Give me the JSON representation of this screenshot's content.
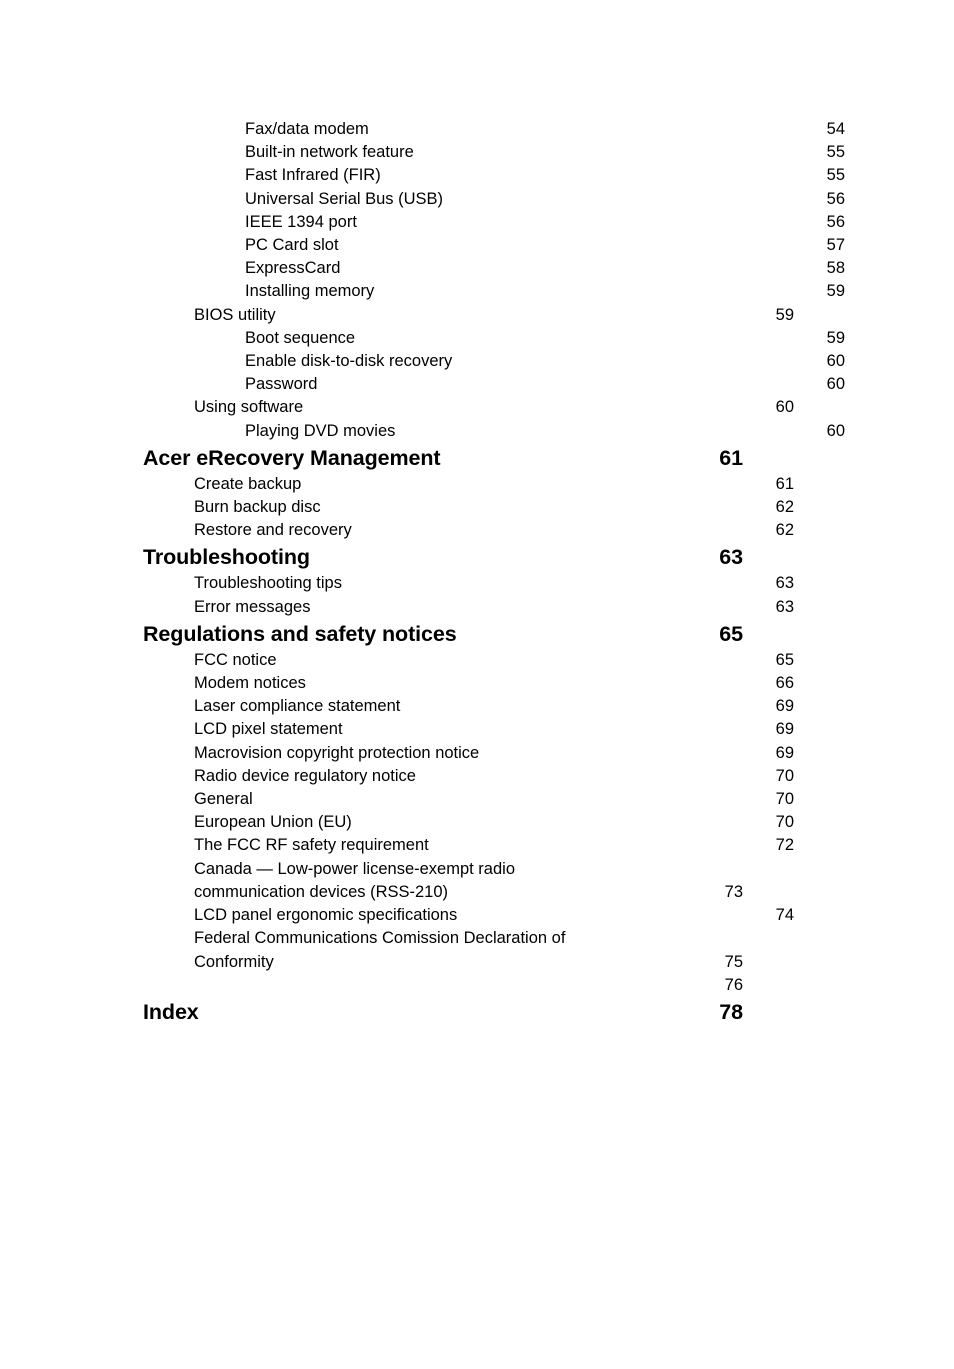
{
  "document": {
    "type": "table-of-contents",
    "page_background": "#ffffff",
    "text_color": "#000000"
  },
  "entries": [
    {
      "level": 2,
      "label": "Fax/data modem",
      "page": "54"
    },
    {
      "level": 2,
      "label": "Built-in network feature",
      "page": "55"
    },
    {
      "level": 2,
      "label": "Fast Infrared (FIR)",
      "page": "55"
    },
    {
      "level": 2,
      "label": "Universal Serial Bus (USB)",
      "page": "56"
    },
    {
      "level": 2,
      "label": "IEEE 1394 port",
      "page": "56"
    },
    {
      "level": 2,
      "label": "PC Card slot",
      "page": "57"
    },
    {
      "level": 2,
      "label": "ExpressCard",
      "page": "58"
    },
    {
      "level": 2,
      "label": "Installing memory",
      "page": "59"
    },
    {
      "level": 1,
      "label": "BIOS utility",
      "page": "59"
    },
    {
      "level": 2,
      "label": "Boot sequence",
      "page": "59"
    },
    {
      "level": 2,
      "label": "Enable disk-to-disk recovery",
      "page": "60"
    },
    {
      "level": 2,
      "label": "Password",
      "page": "60"
    },
    {
      "level": 1,
      "label": "Using software",
      "page": "60"
    },
    {
      "level": 2,
      "label": "Playing DVD movies",
      "page": "60"
    },
    {
      "level": 0,
      "label": "Acer eRecovery Management",
      "page": "61"
    },
    {
      "level": 1,
      "label": "Create backup",
      "page": "61"
    },
    {
      "level": 1,
      "label": "Burn backup disc",
      "page": "62"
    },
    {
      "level": 1,
      "label": "Restore and recovery",
      "page": "62"
    },
    {
      "level": 0,
      "label": "Troubleshooting",
      "page": "63"
    },
    {
      "level": 1,
      "label": "Troubleshooting tips",
      "page": "63"
    },
    {
      "level": 1,
      "label": "Error messages",
      "page": "63"
    },
    {
      "level": 0,
      "label": "Regulations and safety notices",
      "page": "65"
    },
    {
      "level": 1,
      "label": "FCC notice",
      "page": "65"
    },
    {
      "level": 1,
      "label": "Modem notices",
      "page": "66"
    },
    {
      "level": 1,
      "label": "Laser compliance statement",
      "page": "69"
    },
    {
      "level": 1,
      "label": "LCD pixel statement",
      "page": "69"
    },
    {
      "level": 1,
      "label": "Macrovision copyright protection notice",
      "page": "69"
    },
    {
      "level": 1,
      "label": "Radio device regulatory notice",
      "page": "70"
    },
    {
      "level": 1,
      "label": "General",
      "page": "70"
    },
    {
      "level": 1,
      "label": "European Union (EU)",
      "page": "70"
    },
    {
      "level": 1,
      "label": "The FCC RF safety requirement",
      "page": "72"
    },
    {
      "level": 1,
      "wrapped": true,
      "label": "Canada — Low-power license-exempt radio communication devices (RSS-210)",
      "page": "73"
    },
    {
      "level": 1,
      "label": "LCD panel ergonomic specifications",
      "page": "74"
    },
    {
      "level": 1,
      "wrapped": true,
      "label": "Federal Communications Comission Declaration of Conformity",
      "page": "75"
    },
    {
      "level": 1,
      "orphan": true,
      "label": "",
      "page": "76"
    },
    {
      "level": 0,
      "label": "Index",
      "page": "78"
    }
  ]
}
